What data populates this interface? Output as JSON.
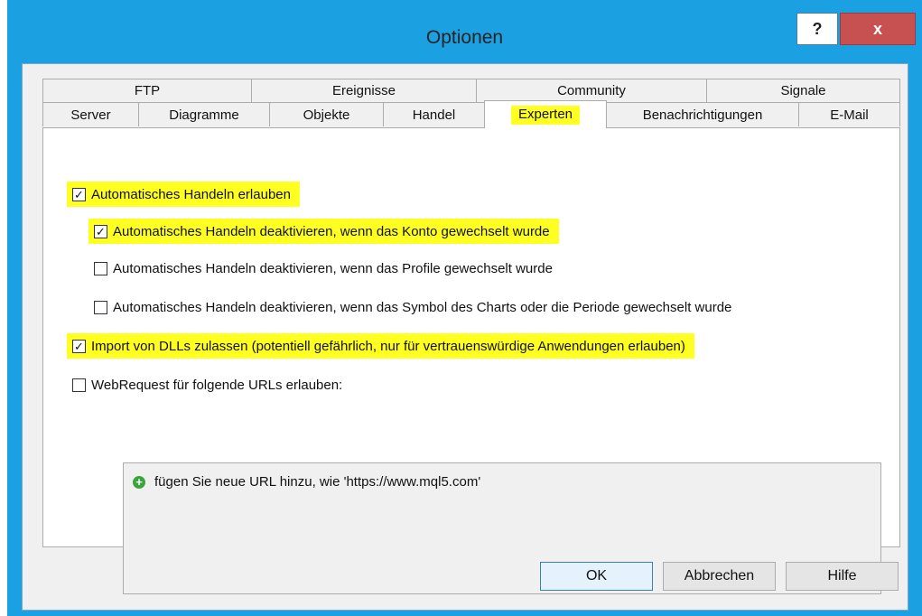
{
  "window": {
    "title": "Optionen",
    "help_glyph": "?",
    "close_glyph": "x"
  },
  "tabs": {
    "row1": [
      "FTP",
      "Ereignisse",
      "Community",
      "Signale"
    ],
    "row2": [
      "Server",
      "Diagramme",
      "Objekte",
      "Handel",
      "Experten",
      "Benachrichtigungen",
      "E-Mail"
    ],
    "active": "Experten"
  },
  "options": [
    {
      "label": "Automatisches Handeln erlauben",
      "checked": true,
      "highlighted": true
    },
    {
      "label": "Automatisches Handeln deaktivieren, wenn das Konto gewechselt wurde",
      "checked": true,
      "highlighted": true
    },
    {
      "label": "Automatisches Handeln deaktivieren, wenn das Profile gewechselt wurde",
      "checked": false,
      "highlighted": false
    },
    {
      "label": "Automatisches Handeln deaktivieren, wenn das Symbol des Charts oder die Periode gewechselt wurde",
      "checked": false,
      "highlighted": false
    },
    {
      "label": "Import von DLLs zulassen (potentiell gefährlich, nur für vertrauenswürdige Anwendungen erlauben)",
      "checked": true,
      "highlighted": true
    },
    {
      "label": "WebRequest für folgende URLs erlauben:",
      "checked": false,
      "highlighted": false
    }
  ],
  "url_list": {
    "add_text": "fügen Sie neue URL hinzu, wie 'https://www.mql5.com'",
    "icon": "add-circle-icon"
  },
  "buttons": {
    "ok": "OK",
    "cancel": "Abbrechen",
    "help": "Hilfe"
  },
  "colors": {
    "title_bar": "#1ba1e2",
    "highlight": "#ffff22",
    "close_button": "#c75050"
  }
}
